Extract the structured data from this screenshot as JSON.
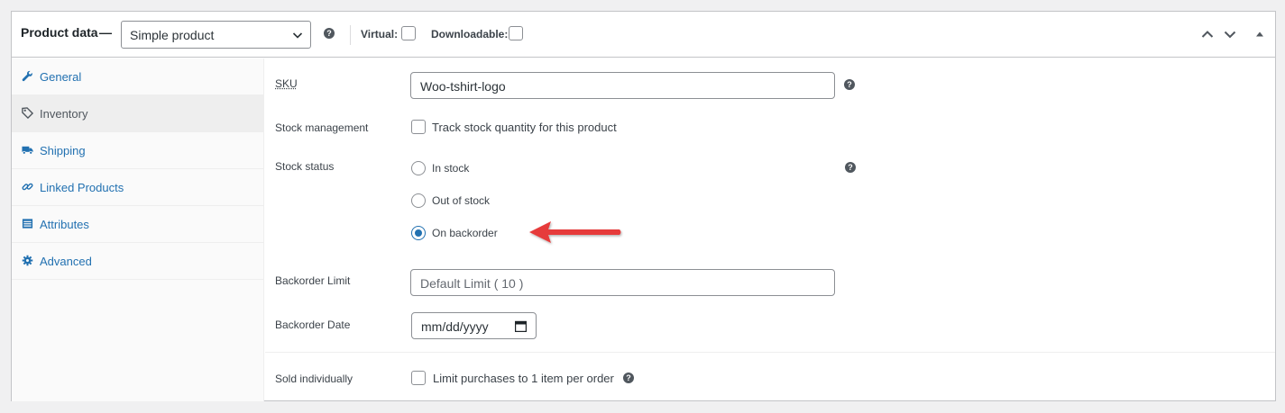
{
  "header": {
    "title": "Product data",
    "dash": "—",
    "product_type": "Simple product",
    "help_glyph": "?",
    "virtual_label": "Virtual:",
    "virtual_checked": false,
    "downloadable_label": "Downloadable:",
    "downloadable_checked": false
  },
  "sidebar": {
    "active": "Inventory",
    "items": [
      {
        "label": "General",
        "icon": "wrench-icon"
      },
      {
        "label": "Inventory",
        "icon": "tag-icon"
      },
      {
        "label": "Shipping",
        "icon": "truck-icon"
      },
      {
        "label": "Linked Products",
        "icon": "link-icon"
      },
      {
        "label": "Attributes",
        "icon": "list-icon"
      },
      {
        "label": "Advanced",
        "icon": "gear-icon"
      }
    ]
  },
  "inventory": {
    "sku_label": "SKU",
    "sku_value": "Woo-tshirt-logo",
    "stock_management_label": "Stock management",
    "stock_management_text": "Track stock quantity for this product",
    "stock_management_checked": false,
    "stock_status_label": "Stock status",
    "stock_status_options": [
      "In stock",
      "Out of stock",
      "On backorder"
    ],
    "stock_status_selected": "On backorder",
    "backorder_limit_label": "Backorder Limit",
    "backorder_limit_placeholder": "Default Limit ( 10 )",
    "backorder_date_label": "Backorder Date",
    "backorder_date_placeholder": "mm/dd/yyyy",
    "sold_individually_label": "Sold individually",
    "sold_individually_text": "Limit purchases to 1 item per order",
    "sold_individually_checked": false
  },
  "colors": {
    "accent": "#2271b1",
    "arrow": "#e63b3b",
    "active_tab_bg": "#eeeeee"
  }
}
